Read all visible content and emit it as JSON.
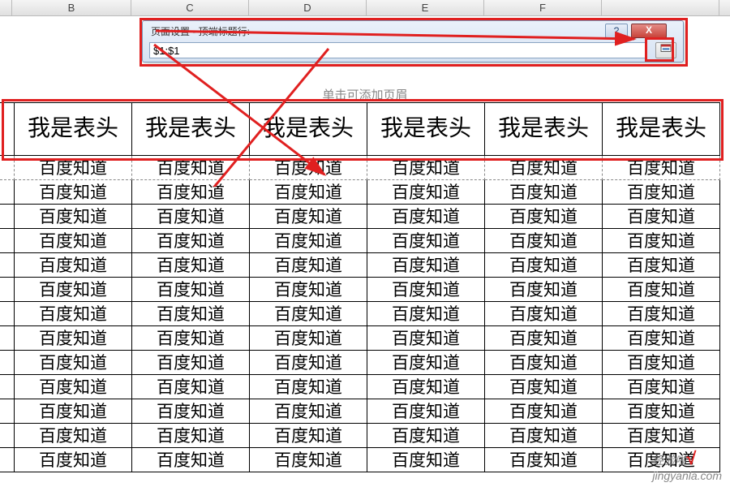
{
  "columns": {
    "B": "B",
    "C": "C",
    "D": "D",
    "E": "E",
    "F": "F"
  },
  "dialog": {
    "title": "页面设置 - 顶端标题行:",
    "help": "?",
    "close": "X",
    "inputValue": "$1:$1"
  },
  "pageHint": "单击可添加页眉",
  "headerText": "我是表头",
  "cellText": "百度知道",
  "watermark": "jingyanla.com",
  "watermarkLabel": "经验啦"
}
